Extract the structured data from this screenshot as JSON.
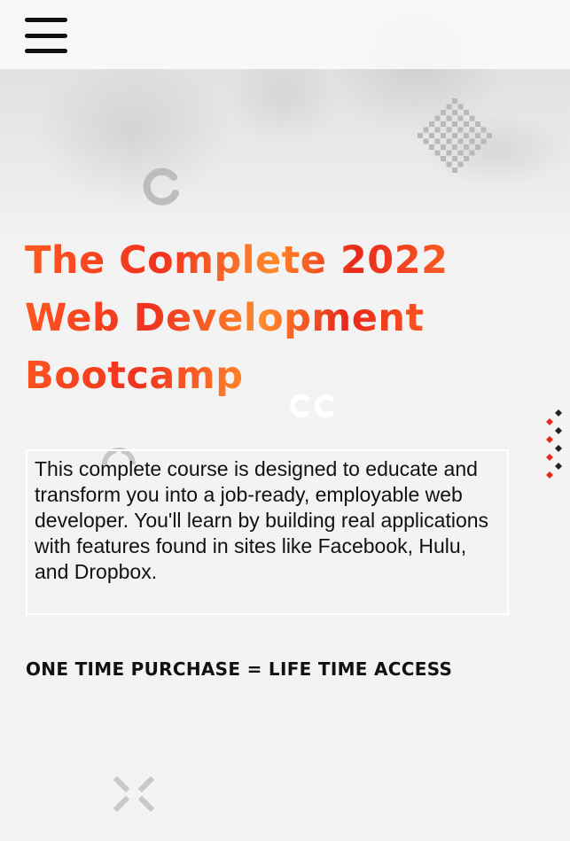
{
  "header": {
    "menu_icon": "hamburger-menu-icon"
  },
  "hero": {
    "headline_lines": [
      "The Complete 2022",
      "Web Development",
      "Bootcamp"
    ],
    "description": "This complete course is designed to educate and transform you into a job-ready, employable web developer. You'll learn by building real applications with features found in sites like Facebook, Hulu, and Dropbox.",
    "tagline": "ONE TIME PURCHASE = LIFE TIME ACCESS"
  },
  "colors": {
    "accent_orange": "#ff5a1f",
    "accent_red": "#e8281c",
    "text_dark": "#111111",
    "background": "#f3f3f3"
  },
  "decorations": [
    "diamond-grid-icon",
    "ring-icon",
    "double-ring-icon",
    "half-ring-icon",
    "zigzag-pattern-icon",
    "cross-arrows-icon"
  ]
}
